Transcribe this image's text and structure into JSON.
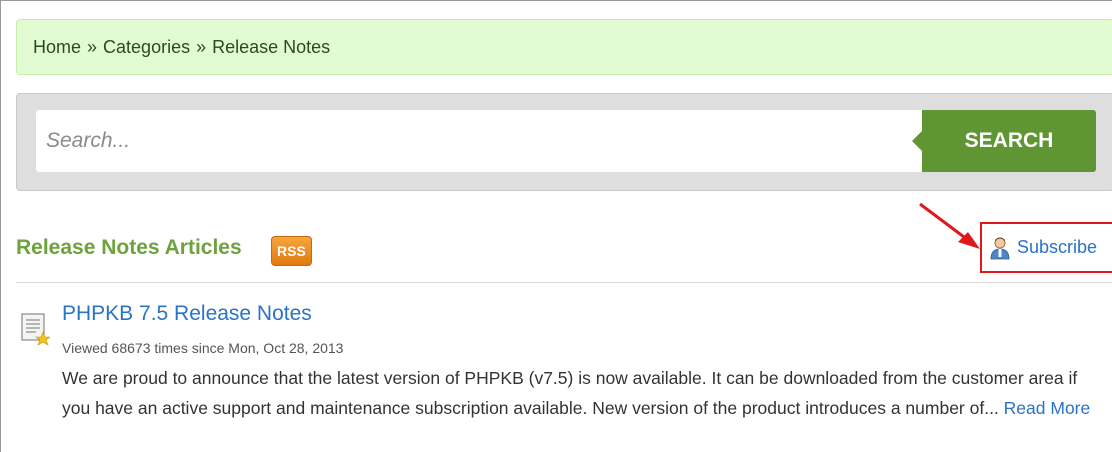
{
  "breadcrumb": {
    "items": [
      "Home",
      "Categories",
      "Release Notes"
    ],
    "separator": "»"
  },
  "search": {
    "placeholder": "Search...",
    "value": "",
    "button_label": "SEARCH"
  },
  "section": {
    "title": "Release Notes Articles",
    "rss_label": "RSS",
    "subscribe_label": "Subscribe"
  },
  "articles": [
    {
      "title": "PHPKB 7.5 Release Notes",
      "meta": "Viewed 68673 times since Mon, Oct 28, 2013",
      "summary": "We are proud to announce that the latest version of PHPKB (v7.5) is now available. It can be downloaded from the customer area if you have an active support and maintenance subscription available. New version of the product introduces a number of... ",
      "read_more": "Read More"
    }
  ],
  "colors": {
    "breadcrumb_bg": "#e3fbd2",
    "search_panel_bg": "#dedede",
    "search_button_bg": "#5f9633",
    "section_title": "#6ea23c",
    "link": "#2a73c5",
    "rss_orange": "#f08c1e",
    "annotation_red": "#e0181c"
  },
  "icons": {
    "article": "article-document-star-icon",
    "subscribe": "user-subscribe-icon"
  }
}
